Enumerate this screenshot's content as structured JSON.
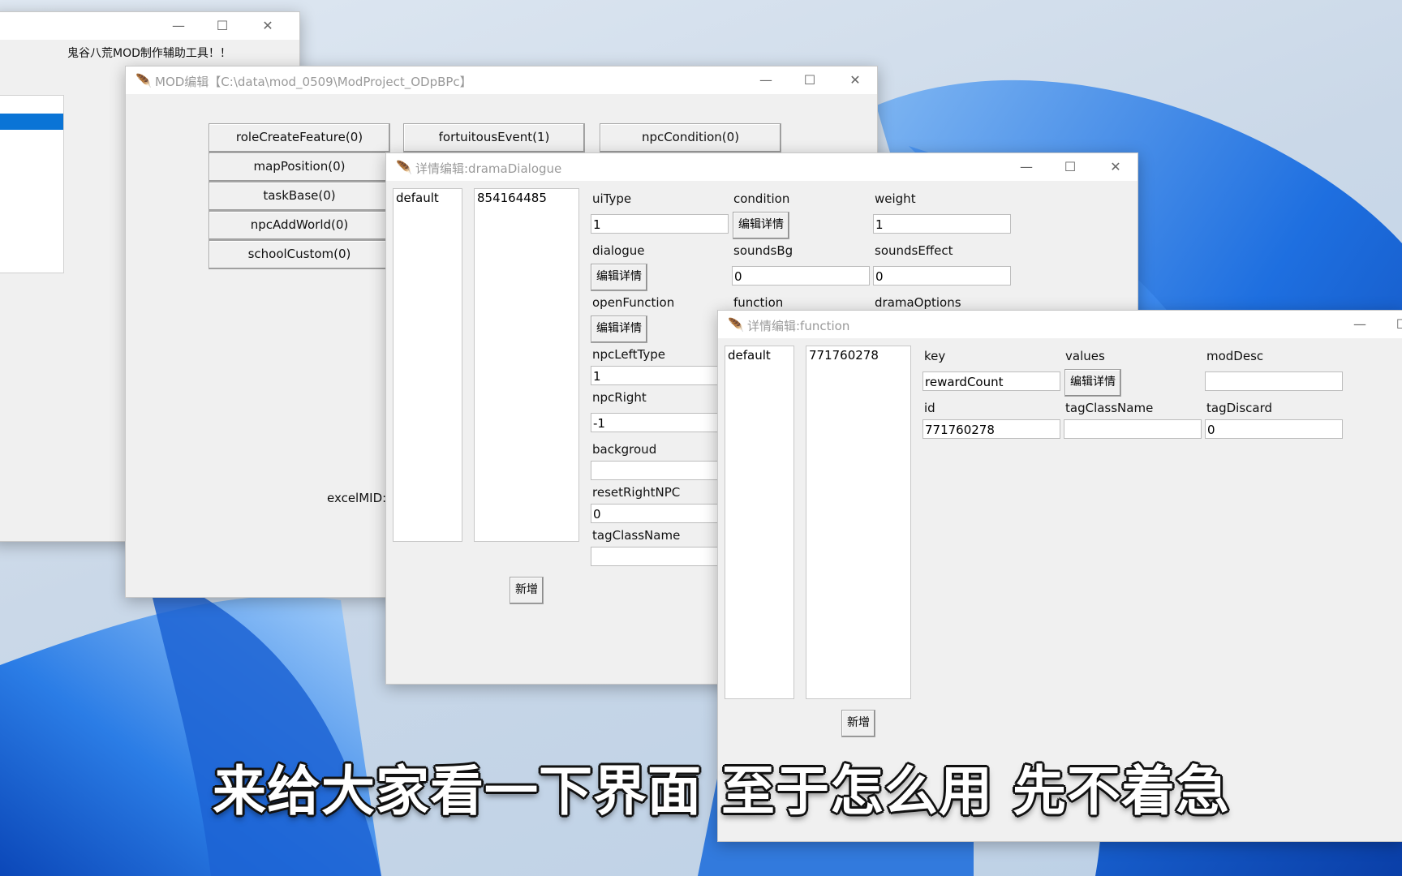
{
  "win_main": {
    "header_text": "鬼谷八荒MOD制作辅助工具！！",
    "controls": {
      "minimize": "—",
      "maximize": "☐",
      "close": "✕"
    }
  },
  "win_mod": {
    "title": "MOD编辑【C:\\data\\mod_0509\\ModProject_ODpBPc】",
    "controls": {
      "minimize": "—",
      "maximize": "☐",
      "close": "✕"
    },
    "buttons": [
      "roleCreateFeature(0)",
      "fortuitousEvent(1)",
      "npcCondition(0)",
      "mapPosition(0)",
      "taskBase(0)",
      "npcAddWorld(0)",
      "schoolCustom(0)"
    ],
    "excel_label": "excelMID:"
  },
  "win_drama": {
    "title": "详情编辑:dramaDialogue",
    "controls": {
      "minimize": "—",
      "maximize": "☐",
      "close": "✕"
    },
    "list_left": [
      "default"
    ],
    "list_right": [
      "854164485"
    ],
    "labels": {
      "uiType": "uiType",
      "condition": "condition",
      "weight": "weight",
      "dialogue": "dialogue",
      "soundsBg": "soundsBg",
      "soundsEffect": "soundsEffect",
      "openFunction": "openFunction",
      "function": "function",
      "dramaOptions": "dramaOptions",
      "npcLeftType": "npcLeftType",
      "npcRight": "npcRight",
      "backgroud": "backgroud",
      "resetRightNPC": "resetRightNPC",
      "tagClassName": "tagClassName"
    },
    "values": {
      "uiType": "1",
      "weight": "1",
      "soundsBg": "0",
      "soundsEffect": "0",
      "npcLeftType": "1",
      "npcRight": "-1",
      "backgroud": "",
      "resetRightNPC": "0",
      "tagClassName": ""
    },
    "edit_label": "编辑详情",
    "add_label": "新增"
  },
  "win_function": {
    "title": "详情编辑:function",
    "controls": {
      "minimize": "—",
      "maximize": "☐"
    },
    "list_left": [
      "default"
    ],
    "list_right": [
      "771760278"
    ],
    "labels": {
      "key": "key",
      "values": "values",
      "modDesc": "modDesc",
      "id": "id",
      "tagClassName": "tagClassName",
      "tagDiscard": "tagDiscard"
    },
    "values": {
      "key": "rewardCount",
      "modDesc": "",
      "id": "771760278",
      "tagClassName": "",
      "tagDiscard": "0"
    },
    "edit_label": "编辑详情",
    "add_label": "新增"
  },
  "subtitle": "来给大家看一下界面 至于怎么用 先不着急",
  "colors": {
    "selection": "#0a74d6",
    "wallpaper_blue": "#1f6fd8"
  }
}
